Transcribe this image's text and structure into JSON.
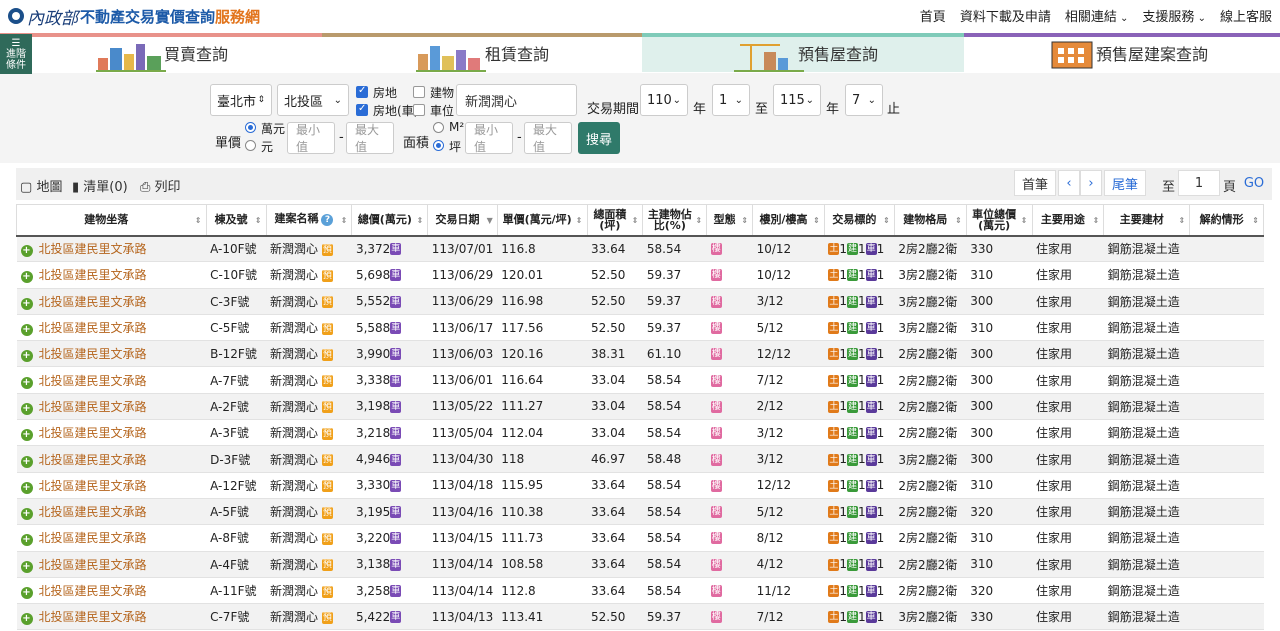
{
  "header": {
    "logo_moi": "內政部",
    "logo_title": "不動產交易實價查詢",
    "logo_suffix": "服務網",
    "nav": [
      "首頁",
      "資料下載及申請",
      "相關連結",
      "支援服務",
      "線上客服"
    ]
  },
  "adv_search": {
    "line1": "進階",
    "line2": "條件"
  },
  "tabs": [
    {
      "label": "買賣查詢",
      "color": "#e8928a"
    },
    {
      "label": "租賃查詢",
      "color": "#b99a6c"
    },
    {
      "label": "預售屋查詢",
      "color": "#7fcbb9"
    },
    {
      "label": "預售屋建案查詢",
      "color": "#8a63b8"
    }
  ],
  "filters": {
    "city": "臺北市",
    "district": "北投區",
    "cb_land_bldg": "房地",
    "cb_bldg": "建物",
    "cb_land_bldg_car": "房地(車)",
    "cb_car": "車位",
    "keyword": "新潤潤心",
    "period_label": "交易期間：",
    "from_year": "110",
    "from_month": "1",
    "to_year": "115",
    "to_month": "7",
    "year_unit": "年",
    "to": "至",
    "end": "止",
    "unit_price_label": "單價",
    "unit_wan": "萬元",
    "unit_yuan": "元",
    "min_placeholder": "最小值",
    "max_placeholder": "最大值",
    "dash": "-",
    "area_label": "面積",
    "area_m2": "M²",
    "area_ping": "坪",
    "search_label": "搜尋"
  },
  "toolbar": {
    "map": "地圖",
    "list": "清單(0)",
    "print": "列印",
    "first": "首筆",
    "last": "尾筆",
    "goto": "至",
    "page": "1",
    "page_unit": "頁",
    "go": "GO"
  },
  "table": {
    "headers": [
      "建物坐落",
      "棟及號",
      "建案名稱",
      "總價(萬元)",
      "交易日期",
      "單價(萬元/坪)",
      "總面積(坪)",
      "主建物佔比(%)",
      "型態",
      "樓別/樓高",
      "交易標的",
      "建物格局",
      "車位總價(萬元)",
      "主要用途",
      "主要建材",
      "解約情形"
    ],
    "badges": {
      "car": "車",
      "presale": "預",
      "bldg": "樓",
      "land": "土",
      "build": "建",
      "carpark": "車"
    },
    "rows": [
      {
        "addr": "北投區建民里文承路",
        "unit": "A-10F號",
        "name": "新潤潤心",
        "price": "3,372",
        "date": "113/07/01",
        "uprice": "116.8",
        "area": "33.64",
        "ratio": "58.54",
        "floor": "10/12",
        "layout": "2房2廳2衛",
        "carprice": "330",
        "use": "住家用",
        "material": "鋼筋混凝土造"
      },
      {
        "addr": "北投區建民里文承路",
        "unit": "C-10F號",
        "name": "新潤潤心",
        "price": "5,698",
        "date": "113/06/29",
        "uprice": "120.01",
        "area": "52.50",
        "ratio": "59.37",
        "floor": "10/12",
        "layout": "3房2廳2衛",
        "carprice": "310",
        "use": "住家用",
        "material": "鋼筋混凝土造"
      },
      {
        "addr": "北投區建民里文承路",
        "unit": "C-3F號",
        "name": "新潤潤心",
        "price": "5,552",
        "date": "113/06/29",
        "uprice": "116.98",
        "area": "52.50",
        "ratio": "59.37",
        "floor": "3/12",
        "layout": "3房2廳2衛",
        "carprice": "300",
        "use": "住家用",
        "material": "鋼筋混凝土造"
      },
      {
        "addr": "北投區建民里文承路",
        "unit": "C-5F號",
        "name": "新潤潤心",
        "price": "5,588",
        "date": "113/06/17",
        "uprice": "117.56",
        "area": "52.50",
        "ratio": "59.37",
        "floor": "5/12",
        "layout": "3房2廳2衛",
        "carprice": "310",
        "use": "住家用",
        "material": "鋼筋混凝土造"
      },
      {
        "addr": "北投區建民里文承路",
        "unit": "B-12F號",
        "name": "新潤潤心",
        "price": "3,990",
        "date": "113/06/03",
        "uprice": "120.16",
        "area": "38.31",
        "ratio": "61.10",
        "floor": "12/12",
        "layout": "2房2廳2衛",
        "carprice": "300",
        "use": "住家用",
        "material": "鋼筋混凝土造"
      },
      {
        "addr": "北投區建民里文承路",
        "unit": "A-7F號",
        "name": "新潤潤心",
        "price": "3,338",
        "date": "113/06/01",
        "uprice": "116.64",
        "area": "33.04",
        "ratio": "58.54",
        "floor": "7/12",
        "layout": "2房2廳2衛",
        "carprice": "300",
        "use": "住家用",
        "material": "鋼筋混凝土造"
      },
      {
        "addr": "北投區建民里文承路",
        "unit": "A-2F號",
        "name": "新潤潤心",
        "price": "3,198",
        "date": "113/05/22",
        "uprice": "111.27",
        "area": "33.04",
        "ratio": "58.54",
        "floor": "2/12",
        "layout": "2房2廳2衛",
        "carprice": "300",
        "use": "住家用",
        "material": "鋼筋混凝土造"
      },
      {
        "addr": "北投區建民里文承路",
        "unit": "A-3F號",
        "name": "新潤潤心",
        "price": "3,218",
        "date": "113/05/04",
        "uprice": "112.04",
        "area": "33.04",
        "ratio": "58.54",
        "floor": "3/12",
        "layout": "2房2廳2衛",
        "carprice": "300",
        "use": "住家用",
        "material": "鋼筋混凝土造"
      },
      {
        "addr": "北投區建民里文承路",
        "unit": "D-3F號",
        "name": "新潤潤心",
        "price": "4,946",
        "date": "113/04/30",
        "uprice": "118",
        "area": "46.97",
        "ratio": "58.48",
        "floor": "3/12",
        "layout": "3房2廳2衛",
        "carprice": "300",
        "use": "住家用",
        "material": "鋼筋混凝土造"
      },
      {
        "addr": "北投區建民里文承路",
        "unit": "A-12F號",
        "name": "新潤潤心",
        "price": "3,330",
        "date": "113/04/18",
        "uprice": "115.95",
        "area": "33.64",
        "ratio": "58.54",
        "floor": "12/12",
        "layout": "2房2廳2衛",
        "carprice": "310",
        "use": "住家用",
        "material": "鋼筋混凝土造"
      },
      {
        "addr": "北投區建民里文承路",
        "unit": "A-5F號",
        "name": "新潤潤心",
        "price": "3,195",
        "date": "113/04/16",
        "uprice": "110.38",
        "area": "33.64",
        "ratio": "58.54",
        "floor": "5/12",
        "layout": "2房2廳2衛",
        "carprice": "320",
        "use": "住家用",
        "material": "鋼筋混凝土造"
      },
      {
        "addr": "北投區建民里文承路",
        "unit": "A-8F號",
        "name": "新潤潤心",
        "price": "3,220",
        "date": "113/04/15",
        "uprice": "111.73",
        "area": "33.64",
        "ratio": "58.54",
        "floor": "8/12",
        "layout": "2房2廳2衛",
        "carprice": "310",
        "use": "住家用",
        "material": "鋼筋混凝土造"
      },
      {
        "addr": "北投區建民里文承路",
        "unit": "A-4F號",
        "name": "新潤潤心",
        "price": "3,138",
        "date": "113/04/14",
        "uprice": "108.58",
        "area": "33.64",
        "ratio": "58.54",
        "floor": "4/12",
        "layout": "2房2廳2衛",
        "carprice": "310",
        "use": "住家用",
        "material": "鋼筋混凝土造"
      },
      {
        "addr": "北投區建民里文承路",
        "unit": "A-11F號",
        "name": "新潤潤心",
        "price": "3,258",
        "date": "113/04/14",
        "uprice": "112.8",
        "area": "33.64",
        "ratio": "58.54",
        "floor": "11/12",
        "layout": "2房2廳2衛",
        "carprice": "320",
        "use": "住家用",
        "material": "鋼筋混凝土造"
      },
      {
        "addr": "北投區建民里文承路",
        "unit": "C-7F號",
        "name": "新潤潤心",
        "price": "5,422",
        "date": "113/04/13",
        "uprice": "113.41",
        "area": "52.50",
        "ratio": "59.37",
        "floor": "7/12",
        "layout": "3房2廳2衛",
        "carprice": "330",
        "use": "住家用",
        "material": "鋼筋混凝土造"
      }
    ]
  }
}
